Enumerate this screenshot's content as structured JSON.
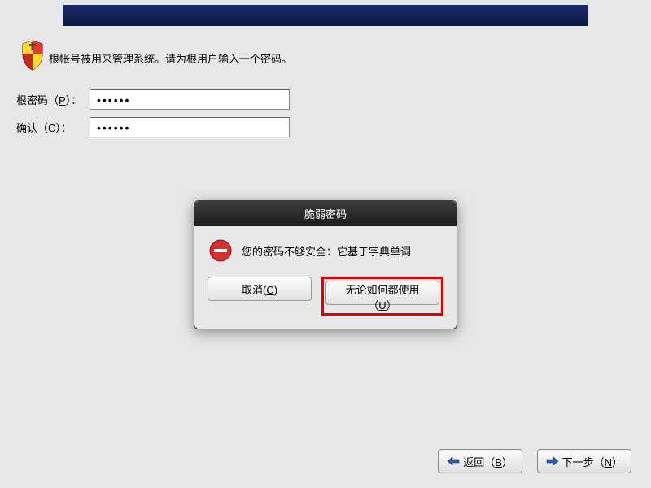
{
  "instruction": "根帐号被用来管理系统。请为根用户输入一个密码。",
  "form": {
    "password_label_pre": "根密码（",
    "password_label_key": "P",
    "password_label_post": "）：",
    "confirm_label_pre": "确认（",
    "confirm_label_key": "C",
    "confirm_label_post": "）：",
    "password_value": "••••••",
    "confirm_value": "••••••"
  },
  "dialog": {
    "title": "脆弱密码",
    "message": "您的密码不够安全：它基于字典单词",
    "cancel_pre": "取消(",
    "cancel_key": "C",
    "cancel_post": ")",
    "use_anyway_pre": "无论如何都使用（",
    "use_anyway_key": "U",
    "use_anyway_post": "）"
  },
  "nav": {
    "back_pre": "返回（",
    "back_key": "B",
    "back_post": "）",
    "next_pre": "下一步（",
    "next_key": "N",
    "next_post": "）"
  }
}
